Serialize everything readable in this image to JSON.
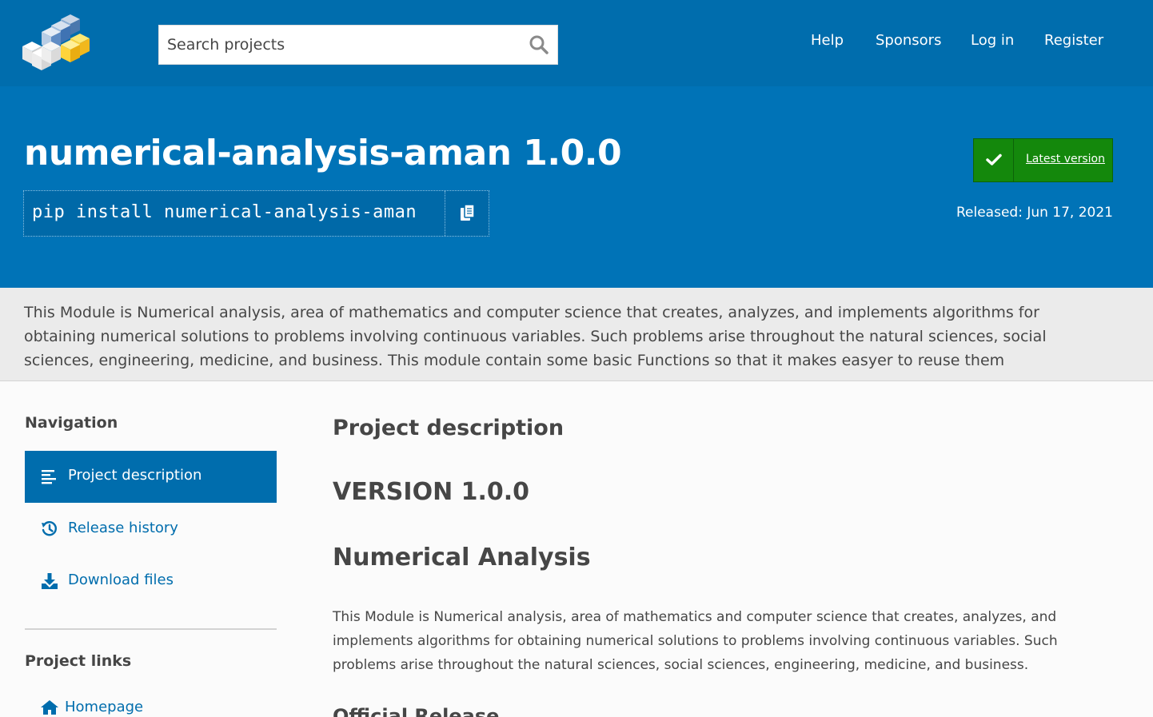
{
  "header": {
    "logo_alt": "PyPI logo",
    "search_placeholder": "Search projects",
    "nav": [
      {
        "label": "Help"
      },
      {
        "label": "Sponsors"
      },
      {
        "label": "Log in"
      },
      {
        "label": "Register"
      }
    ]
  },
  "banner": {
    "title": "numerical-analysis-aman 1.0.0",
    "pip_command": "pip install numerical-analysis-aman",
    "latest_version_label": "Latest version",
    "released": "Released: Jun 17, 2021"
  },
  "summary": "This Module is Numerical analysis, area of mathematics and computer science that creates, analyzes, and implements algorithms for obtaining numerical solutions to problems involving continuous variables. Such problems arise throughout the natural sciences, social sciences, engineering, medicine, and business. This module contain some basic Functions so that it makes easyer to reuse them",
  "sidebar": {
    "navigation_heading": "Navigation",
    "items": [
      {
        "label": "Project description",
        "icon": "align-left-icon",
        "active": true
      },
      {
        "label": "Release history",
        "icon": "history-icon",
        "active": false
      },
      {
        "label": "Download files",
        "icon": "download-icon",
        "active": false
      }
    ],
    "links_heading": "Project links",
    "links": [
      {
        "label": "Homepage",
        "icon": "home-icon"
      }
    ]
  },
  "main": {
    "section_heading": "Project description",
    "version_heading": "VERSION 1.0.0",
    "title_heading": "Numerical Analysis",
    "description": "This Module is Numerical analysis, area of mathematics and computer science that creates, analyzes, and implements algorithms for obtaining numerical solutions to problems involving continuous variables. Such problems arise throughout the natural sciences, social sciences, engineering, medicine, and business.",
    "next_heading": "Official Release"
  },
  "colors": {
    "header": "#006dad",
    "banner": "#0073b7",
    "latest_badge": "#14880c",
    "link": "#006dad",
    "summary_bg": "#ebebeb"
  }
}
